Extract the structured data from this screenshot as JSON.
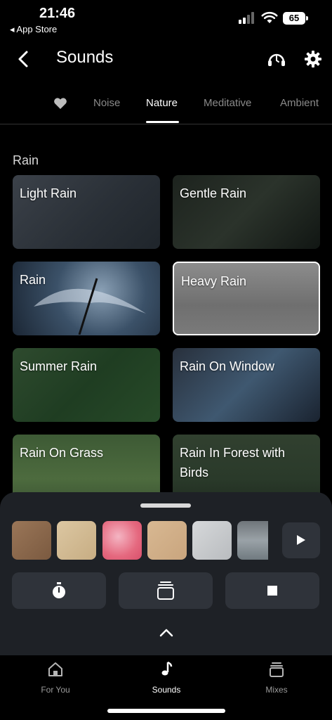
{
  "status": {
    "time": "21:46",
    "back_to": "◂ App Store",
    "battery": "65"
  },
  "header": {
    "title": "Sounds"
  },
  "tabs": [
    "Noise",
    "Nature",
    "Meditative",
    "Ambient"
  ],
  "active_tab": "Nature",
  "section": {
    "title": "Rain"
  },
  "cards": [
    {
      "label": "Light Rain"
    },
    {
      "label": "Gentle Rain"
    },
    {
      "label": "Rain"
    },
    {
      "label": "Heavy Rain",
      "selected": true
    },
    {
      "label": "Summer Rain"
    },
    {
      "label": "Rain On Window"
    },
    {
      "label": "Rain On Grass"
    },
    {
      "label": "Rain In Forest with Birds"
    }
  ],
  "tabbar": {
    "for_you": "For You",
    "sounds": "Sounds",
    "mixes": "Mixes"
  },
  "colors": {
    "background": "#000000",
    "sheet": "#1e2126",
    "button": "#2f333a",
    "inactive_text": "#8a8a8a"
  }
}
